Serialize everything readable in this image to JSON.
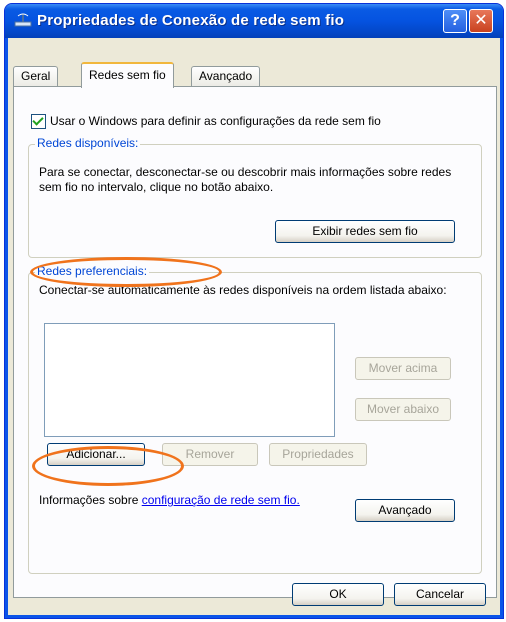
{
  "window": {
    "title": "Propriedades de Conexão de rede sem fio",
    "help_label": "?",
    "close_label": "✕",
    "icon": "wireless-network-icon"
  },
  "tabs": [
    {
      "label": "Geral"
    },
    {
      "label": "Redes sem fio",
      "selected": true
    },
    {
      "label": "Avançado"
    }
  ],
  "wireless": {
    "checkbox_label": "Usar o Windows para definir as configurações da rede sem fio",
    "checkbox_checked": true,
    "available": {
      "title": "Redes disponíveis:",
      "description": "Para se conectar, desconectar-se ou descobrir mais informações sobre redes sem fio no intervalo, clique no botão abaixo.",
      "view_button": "Exibir redes sem fio"
    },
    "preferred": {
      "title": "Redes preferenciais:",
      "description": "Conectar-se automaticamente às redes disponíveis na ordem listada abaixo:",
      "list_items": [],
      "move_up": "Mover acima",
      "move_down": "Mover abaixo",
      "add": "Adicionar...",
      "remove": "Remover",
      "properties": "Propriedades"
    },
    "info_text": "Informações sobre ",
    "info_link": "configuração de rede sem fio.",
    "advanced_button": "Avançado"
  },
  "footer": {
    "ok": "OK",
    "cancel": "Cancelar"
  },
  "colors": {
    "titlebar": "#0553e0",
    "highlight_oval": "#f0731c",
    "group_title": "#0046d5"
  }
}
